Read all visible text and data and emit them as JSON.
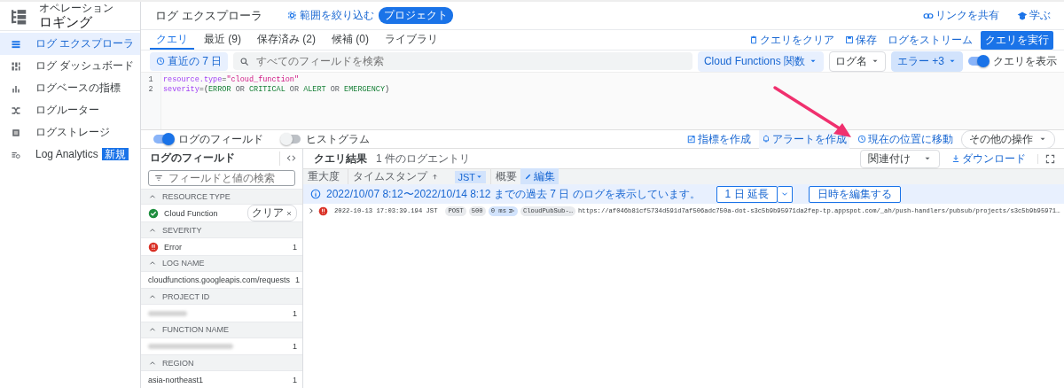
{
  "app": {
    "section": "オペレーション",
    "title": "ロギング"
  },
  "sidebar": {
    "items": [
      {
        "label": "ログ エクスプローラ",
        "selected": true
      },
      {
        "label": "ログ ダッシュボード",
        "selected": false
      },
      {
        "label": "ログベースの指標",
        "selected": false
      },
      {
        "label": "ログルーター",
        "selected": false
      },
      {
        "label": "ログストレージ",
        "selected": false
      },
      {
        "label": "Log Analytics",
        "selected": false,
        "badge": "新規"
      }
    ]
  },
  "header": {
    "title": "ログ エクスプローラ",
    "refine_scope": "範囲を絞り込む",
    "scope_badge": "プロジェクト",
    "actions": [
      {
        "label": "リンクを共有"
      },
      {
        "label": "学ぶ"
      }
    ]
  },
  "tabs": [
    {
      "label": "クエリ",
      "selected": true
    },
    {
      "label": "最近 (9)",
      "selected": false
    },
    {
      "label": "保存済み (2)",
      "selected": false
    },
    {
      "label": "候補 (0)",
      "selected": false
    },
    {
      "label": "ライブラリ",
      "selected": false
    }
  ],
  "tab_actions": [
    {
      "label": "クエリをクリア",
      "kind": "link"
    },
    {
      "label": "保存",
      "kind": "link"
    },
    {
      "label": "ログをストリーム",
      "kind": "link"
    },
    {
      "label": "クエリを実行",
      "kind": "primary"
    }
  ],
  "filters": {
    "time_range": "直近の 7 日",
    "search": {
      "placeholder": "すべてのフィールドを検索"
    },
    "chips": [
      {
        "label": "Cloud Functions 関数",
        "active": true
      },
      {
        "label": "ログ名",
        "active": false
      },
      {
        "label": "エラー +3",
        "active": true
      }
    ],
    "show_query": {
      "label": "クエリを表示",
      "on": true
    }
  },
  "query": {
    "lines": [
      {
        "number": "1",
        "tokens": [
          {
            "text": "resource.type",
            "kind": "key"
          },
          {
            "text": "=",
            "kind": "op"
          },
          {
            "text": "\"cloud_function\"",
            "kind": "string"
          }
        ]
      },
      {
        "number": "2",
        "tokens": [
          {
            "text": "severity",
            "kind": "key"
          },
          {
            "text": "=(",
            "kind": "op"
          },
          {
            "text": "ERROR",
            "kind": "value"
          },
          {
            "text": " OR ",
            "kind": "keyword"
          },
          {
            "text": "CRITICAL",
            "kind": "value"
          },
          {
            "text": " OR ",
            "kind": "keyword"
          },
          {
            "text": "ALERT",
            "kind": "value"
          },
          {
            "text": " OR ",
            "kind": "keyword"
          },
          {
            "text": "EMERGENCY",
            "kind": "value"
          },
          {
            "text": ")",
            "kind": "op"
          }
        ]
      }
    ]
  },
  "view_toggles": [
    {
      "label": "ログのフィールド",
      "on": true
    },
    {
      "label": "ヒストグラム",
      "on": false
    }
  ],
  "query_actions": [
    {
      "label": "指標を作成",
      "highlighted": false
    },
    {
      "label": "アラートを作成",
      "highlighted": true
    },
    {
      "label": "現在の位置に移動",
      "highlighted": false
    }
  ],
  "more_actions": "その他の操作",
  "fields_panel": {
    "title": "ログのフィールド",
    "search": {
      "placeholder": "フィールドと値の検索"
    },
    "sections": [
      {
        "title": "RESOURCE TYPE",
        "expanded": true,
        "values": [
          {
            "label": "Cloud Function",
            "kind": "resource",
            "clear": "クリア"
          }
        ]
      },
      {
        "title": "SEVERITY",
        "expanded": true,
        "values": [
          {
            "label": "Error",
            "kind": "severity",
            "count": "1"
          }
        ]
      },
      {
        "title": "LOG NAME",
        "expanded": true,
        "values": [
          {
            "label": "cloudfunctions.googleapis.com/requests",
            "count": "1"
          }
        ]
      },
      {
        "title": "PROJECT ID",
        "expanded": true,
        "values": [
          {
            "redacted": true,
            "count": "1"
          }
        ]
      },
      {
        "title": "FUNCTION NAME",
        "expanded": true,
        "values": [
          {
            "redacted": true,
            "count": "1"
          }
        ]
      },
      {
        "title": "REGION",
        "expanded": true,
        "values": [
          {
            "label": "asia-northeast1",
            "count": "1"
          }
        ]
      }
    ]
  },
  "results": {
    "title": "クエリ結果",
    "summary": "1 件のログエントリ",
    "correlate": "関連付け",
    "download": "ダウンロード",
    "columns": [
      {
        "label": "重大度"
      },
      {
        "label": "タイムスタンプ"
      },
      {
        "label": "概要"
      }
    ],
    "timezone": "JST",
    "edit": "編集",
    "notice": {
      "text": "2022/10/07 8:12〜2022/10/14 8:12 までの過去 7 日 のログを表示しています。",
      "extend": "1 日 延長",
      "edit_time": "日時を編集する"
    },
    "entries": [
      {
        "expanded": false,
        "timestamp": "2022-10-13 17:03:39.194 JST",
        "chips": [
          {
            "label": "POST",
            "kind": "plain"
          },
          {
            "label": "500",
            "kind": "plain"
          },
          {
            "label": "0 ms",
            "kind": "latency"
          },
          {
            "label": "CloudPubSub-…",
            "kind": "plain"
          }
        ],
        "text": "https://af046b81cf5734d591d7af506adc750a-dot-s3c5b9b95971da2fep-tp.appspot.com/_ah/push-handlers/pubsub/projects/s3c5b9b95971…"
      }
    ]
  }
}
